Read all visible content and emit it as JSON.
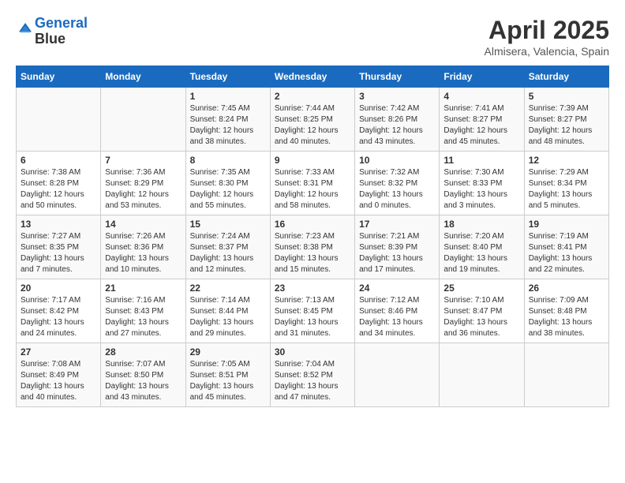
{
  "logo": {
    "line1": "General",
    "line2": "Blue"
  },
  "title": "April 2025",
  "subtitle": "Almisera, Valencia, Spain",
  "days_of_week": [
    "Sunday",
    "Monday",
    "Tuesday",
    "Wednesday",
    "Thursday",
    "Friday",
    "Saturday"
  ],
  "weeks": [
    [
      {
        "day": "",
        "info": ""
      },
      {
        "day": "",
        "info": ""
      },
      {
        "day": "1",
        "info": "Sunrise: 7:45 AM\nSunset: 8:24 PM\nDaylight: 12 hours and 38 minutes."
      },
      {
        "day": "2",
        "info": "Sunrise: 7:44 AM\nSunset: 8:25 PM\nDaylight: 12 hours and 40 minutes."
      },
      {
        "day": "3",
        "info": "Sunrise: 7:42 AM\nSunset: 8:26 PM\nDaylight: 12 hours and 43 minutes."
      },
      {
        "day": "4",
        "info": "Sunrise: 7:41 AM\nSunset: 8:27 PM\nDaylight: 12 hours and 45 minutes."
      },
      {
        "day": "5",
        "info": "Sunrise: 7:39 AM\nSunset: 8:27 PM\nDaylight: 12 hours and 48 minutes."
      }
    ],
    [
      {
        "day": "6",
        "info": "Sunrise: 7:38 AM\nSunset: 8:28 PM\nDaylight: 12 hours and 50 minutes."
      },
      {
        "day": "7",
        "info": "Sunrise: 7:36 AM\nSunset: 8:29 PM\nDaylight: 12 hours and 53 minutes."
      },
      {
        "day": "8",
        "info": "Sunrise: 7:35 AM\nSunset: 8:30 PM\nDaylight: 12 hours and 55 minutes."
      },
      {
        "day": "9",
        "info": "Sunrise: 7:33 AM\nSunset: 8:31 PM\nDaylight: 12 hours and 58 minutes."
      },
      {
        "day": "10",
        "info": "Sunrise: 7:32 AM\nSunset: 8:32 PM\nDaylight: 13 hours and 0 minutes."
      },
      {
        "day": "11",
        "info": "Sunrise: 7:30 AM\nSunset: 8:33 PM\nDaylight: 13 hours and 3 minutes."
      },
      {
        "day": "12",
        "info": "Sunrise: 7:29 AM\nSunset: 8:34 PM\nDaylight: 13 hours and 5 minutes."
      }
    ],
    [
      {
        "day": "13",
        "info": "Sunrise: 7:27 AM\nSunset: 8:35 PM\nDaylight: 13 hours and 7 minutes."
      },
      {
        "day": "14",
        "info": "Sunrise: 7:26 AM\nSunset: 8:36 PM\nDaylight: 13 hours and 10 minutes."
      },
      {
        "day": "15",
        "info": "Sunrise: 7:24 AM\nSunset: 8:37 PM\nDaylight: 13 hours and 12 minutes."
      },
      {
        "day": "16",
        "info": "Sunrise: 7:23 AM\nSunset: 8:38 PM\nDaylight: 13 hours and 15 minutes."
      },
      {
        "day": "17",
        "info": "Sunrise: 7:21 AM\nSunset: 8:39 PM\nDaylight: 13 hours and 17 minutes."
      },
      {
        "day": "18",
        "info": "Sunrise: 7:20 AM\nSunset: 8:40 PM\nDaylight: 13 hours and 19 minutes."
      },
      {
        "day": "19",
        "info": "Sunrise: 7:19 AM\nSunset: 8:41 PM\nDaylight: 13 hours and 22 minutes."
      }
    ],
    [
      {
        "day": "20",
        "info": "Sunrise: 7:17 AM\nSunset: 8:42 PM\nDaylight: 13 hours and 24 minutes."
      },
      {
        "day": "21",
        "info": "Sunrise: 7:16 AM\nSunset: 8:43 PM\nDaylight: 13 hours and 27 minutes."
      },
      {
        "day": "22",
        "info": "Sunrise: 7:14 AM\nSunset: 8:44 PM\nDaylight: 13 hours and 29 minutes."
      },
      {
        "day": "23",
        "info": "Sunrise: 7:13 AM\nSunset: 8:45 PM\nDaylight: 13 hours and 31 minutes."
      },
      {
        "day": "24",
        "info": "Sunrise: 7:12 AM\nSunset: 8:46 PM\nDaylight: 13 hours and 34 minutes."
      },
      {
        "day": "25",
        "info": "Sunrise: 7:10 AM\nSunset: 8:47 PM\nDaylight: 13 hours and 36 minutes."
      },
      {
        "day": "26",
        "info": "Sunrise: 7:09 AM\nSunset: 8:48 PM\nDaylight: 13 hours and 38 minutes."
      }
    ],
    [
      {
        "day": "27",
        "info": "Sunrise: 7:08 AM\nSunset: 8:49 PM\nDaylight: 13 hours and 40 minutes."
      },
      {
        "day": "28",
        "info": "Sunrise: 7:07 AM\nSunset: 8:50 PM\nDaylight: 13 hours and 43 minutes."
      },
      {
        "day": "29",
        "info": "Sunrise: 7:05 AM\nSunset: 8:51 PM\nDaylight: 13 hours and 45 minutes."
      },
      {
        "day": "30",
        "info": "Sunrise: 7:04 AM\nSunset: 8:52 PM\nDaylight: 13 hours and 47 minutes."
      },
      {
        "day": "",
        "info": ""
      },
      {
        "day": "",
        "info": ""
      },
      {
        "day": "",
        "info": ""
      }
    ]
  ]
}
